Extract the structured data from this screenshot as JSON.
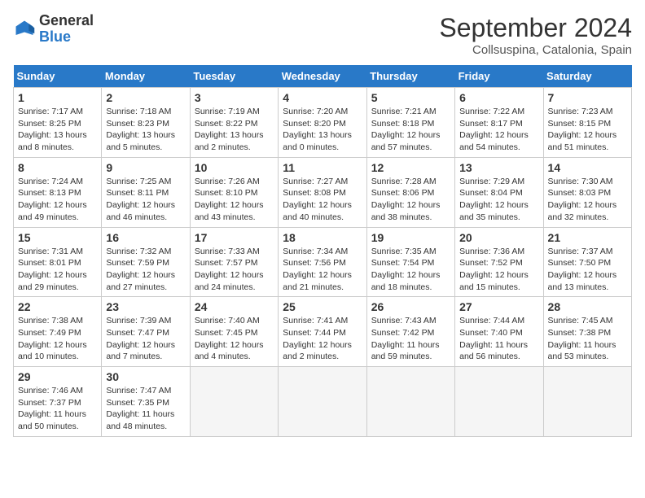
{
  "logo": {
    "general": "General",
    "blue": "Blue"
  },
  "title": "September 2024",
  "subtitle": "Collsuspina, Catalonia, Spain",
  "days_header": [
    "Sunday",
    "Monday",
    "Tuesday",
    "Wednesday",
    "Thursday",
    "Friday",
    "Saturday"
  ],
  "weeks": [
    [
      {
        "day": "1",
        "sunrise": "7:17 AM",
        "sunset": "8:25 PM",
        "daylight": "13 hours and 8 minutes."
      },
      {
        "day": "2",
        "sunrise": "7:18 AM",
        "sunset": "8:23 PM",
        "daylight": "13 hours and 5 minutes."
      },
      {
        "day": "3",
        "sunrise": "7:19 AM",
        "sunset": "8:22 PM",
        "daylight": "13 hours and 2 minutes."
      },
      {
        "day": "4",
        "sunrise": "7:20 AM",
        "sunset": "8:20 PM",
        "daylight": "13 hours and 0 minutes."
      },
      {
        "day": "5",
        "sunrise": "7:21 AM",
        "sunset": "8:18 PM",
        "daylight": "12 hours and 57 minutes."
      },
      {
        "day": "6",
        "sunrise": "7:22 AM",
        "sunset": "8:17 PM",
        "daylight": "12 hours and 54 minutes."
      },
      {
        "day": "7",
        "sunrise": "7:23 AM",
        "sunset": "8:15 PM",
        "daylight": "12 hours and 51 minutes."
      }
    ],
    [
      {
        "day": "8",
        "sunrise": "7:24 AM",
        "sunset": "8:13 PM",
        "daylight": "12 hours and 49 minutes."
      },
      {
        "day": "9",
        "sunrise": "7:25 AM",
        "sunset": "8:11 PM",
        "daylight": "12 hours and 46 minutes."
      },
      {
        "day": "10",
        "sunrise": "7:26 AM",
        "sunset": "8:10 PM",
        "daylight": "12 hours and 43 minutes."
      },
      {
        "day": "11",
        "sunrise": "7:27 AM",
        "sunset": "8:08 PM",
        "daylight": "12 hours and 40 minutes."
      },
      {
        "day": "12",
        "sunrise": "7:28 AM",
        "sunset": "8:06 PM",
        "daylight": "12 hours and 38 minutes."
      },
      {
        "day": "13",
        "sunrise": "7:29 AM",
        "sunset": "8:04 PM",
        "daylight": "12 hours and 35 minutes."
      },
      {
        "day": "14",
        "sunrise": "7:30 AM",
        "sunset": "8:03 PM",
        "daylight": "12 hours and 32 minutes."
      }
    ],
    [
      {
        "day": "15",
        "sunrise": "7:31 AM",
        "sunset": "8:01 PM",
        "daylight": "12 hours and 29 minutes."
      },
      {
        "day": "16",
        "sunrise": "7:32 AM",
        "sunset": "7:59 PM",
        "daylight": "12 hours and 27 minutes."
      },
      {
        "day": "17",
        "sunrise": "7:33 AM",
        "sunset": "7:57 PM",
        "daylight": "12 hours and 24 minutes."
      },
      {
        "day": "18",
        "sunrise": "7:34 AM",
        "sunset": "7:56 PM",
        "daylight": "12 hours and 21 minutes."
      },
      {
        "day": "19",
        "sunrise": "7:35 AM",
        "sunset": "7:54 PM",
        "daylight": "12 hours and 18 minutes."
      },
      {
        "day": "20",
        "sunrise": "7:36 AM",
        "sunset": "7:52 PM",
        "daylight": "12 hours and 15 minutes."
      },
      {
        "day": "21",
        "sunrise": "7:37 AM",
        "sunset": "7:50 PM",
        "daylight": "12 hours and 13 minutes."
      }
    ],
    [
      {
        "day": "22",
        "sunrise": "7:38 AM",
        "sunset": "7:49 PM",
        "daylight": "12 hours and 10 minutes."
      },
      {
        "day": "23",
        "sunrise": "7:39 AM",
        "sunset": "7:47 PM",
        "daylight": "12 hours and 7 minutes."
      },
      {
        "day": "24",
        "sunrise": "7:40 AM",
        "sunset": "7:45 PM",
        "daylight": "12 hours and 4 minutes."
      },
      {
        "day": "25",
        "sunrise": "7:41 AM",
        "sunset": "7:44 PM",
        "daylight": "12 hours and 2 minutes."
      },
      {
        "day": "26",
        "sunrise": "7:43 AM",
        "sunset": "7:42 PM",
        "daylight": "11 hours and 59 minutes."
      },
      {
        "day": "27",
        "sunrise": "7:44 AM",
        "sunset": "7:40 PM",
        "daylight": "11 hours and 56 minutes."
      },
      {
        "day": "28",
        "sunrise": "7:45 AM",
        "sunset": "7:38 PM",
        "daylight": "11 hours and 53 minutes."
      }
    ],
    [
      {
        "day": "29",
        "sunrise": "7:46 AM",
        "sunset": "7:37 PM",
        "daylight": "11 hours and 50 minutes."
      },
      {
        "day": "30",
        "sunrise": "7:47 AM",
        "sunset": "7:35 PM",
        "daylight": "11 hours and 48 minutes."
      },
      null,
      null,
      null,
      null,
      null
    ]
  ]
}
